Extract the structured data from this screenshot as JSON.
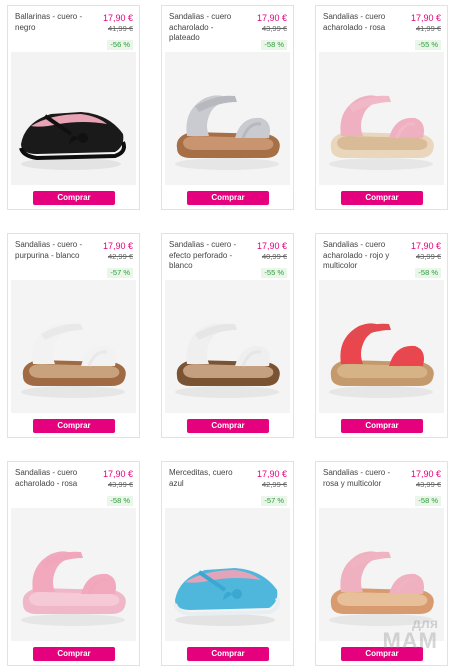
{
  "products": [
    {
      "title": "Ballarinas - cuero - negro",
      "price": "17,90 €",
      "old_price": "41,99 €",
      "discount": "-56 %",
      "button": "Comprar",
      "colors": {
        "main": "#1a1a1a",
        "strap": "#111111",
        "sole": "#0d0d0d",
        "lining": "#e8a3b5",
        "bg": "#f3f3f3"
      },
      "type": "ballerina",
      "icon": "ballerina-shoe-icon"
    },
    {
      "title": "Sandalias - cuero acharolado - plateado",
      "price": "17,90 €",
      "old_price": "43,99 €",
      "discount": "-58 %",
      "button": "Comprar",
      "colors": {
        "main": "#c9cbd0",
        "strap": "#b7b9be",
        "sole": "#a76f45",
        "lining": "#c99470",
        "bg": "#f4f4f4"
      },
      "type": "sandal",
      "icon": "sandal-icon"
    },
    {
      "title": "Sandalias - cuero acharolado - rosa",
      "price": "17,90 €",
      "old_price": "41,99 €",
      "discount": "-55 %",
      "button": "Comprar",
      "colors": {
        "main": "#efb1c2",
        "strap": "#f1b9c8",
        "sole": "#e9d6bd",
        "lining": "#d9bb98",
        "bg": "#f4f4f4"
      },
      "type": "sandal",
      "icon": "sandal-icon"
    },
    {
      "title": "Sandalias - cuero - purpurina - blanco",
      "price": "17,90 €",
      "old_price": "42,99 €",
      "discount": "-57 %",
      "button": "Comprar",
      "colors": {
        "main": "#f2f2f2",
        "strap": "#e9e9e9",
        "sole": "#a06a42",
        "lining": "#c8a27d",
        "bg": "#f4f4f4"
      },
      "type": "sandal",
      "icon": "sandal-icon"
    },
    {
      "title": "Sandalias - cuero - efecto perforado - blanco",
      "price": "17,90 €",
      "old_price": "40,99 €",
      "discount": "-55 %",
      "button": "Comprar",
      "colors": {
        "main": "#efefef",
        "strap": "#e6e6e6",
        "sole": "#7a5332",
        "lining": "#c5a080",
        "bg": "#f4f4f4"
      },
      "type": "sandal",
      "icon": "sandal-icon"
    },
    {
      "title": "Sandalias - cuero acharolado - rojo y multicolor",
      "price": "17,90 €",
      "old_price": "43,99 €",
      "discount": "-58 %",
      "button": "Comprar",
      "colors": {
        "main": "#e9464d",
        "strap": "#e24a52",
        "sole": "#c49a6c",
        "lining": "#d6b387",
        "bg": "#f4f4f4"
      },
      "type": "sandal",
      "icon": "sandal-icon"
    },
    {
      "title": "Sandalias - cuero acharolado - rosa",
      "price": "17,90 €",
      "old_price": "43,99 €",
      "discount": "-58 %",
      "button": "Comprar",
      "colors": {
        "main": "#f2a9bd",
        "strap": "#f0a7bb",
        "sole": "#efb7c8",
        "lining": "#f6c9d6",
        "bg": "#f4f4f4"
      },
      "type": "sandal",
      "icon": "sandal-icon"
    },
    {
      "title": "Merceditas, cuero azul",
      "price": "17,90 €",
      "old_price": "42,99 €",
      "discount": "-57 %",
      "button": "Comprar",
      "colors": {
        "main": "#4fb7dc",
        "strap": "#3aa8d3",
        "sole": "#e9eef2",
        "lining": "#e3a4b9",
        "bg": "#f4f4f4"
      },
      "type": "ballerina",
      "icon": "mary-jane-shoe-icon"
    },
    {
      "title": "Sandalias - cuero - rosa y multicolor",
      "price": "17,90 €",
      "old_price": "43,99 €",
      "discount": "-58 %",
      "button": "Comprar",
      "colors": {
        "main": "#efb1bf",
        "strap": "#f0b3c2",
        "sole": "#d89b70",
        "lining": "#e7bf98",
        "bg": "#f4f4f4"
      },
      "type": "sandal",
      "icon": "sandal-icon"
    }
  ],
  "watermark": {
    "line1": "для",
    "line2": "МАМ"
  }
}
